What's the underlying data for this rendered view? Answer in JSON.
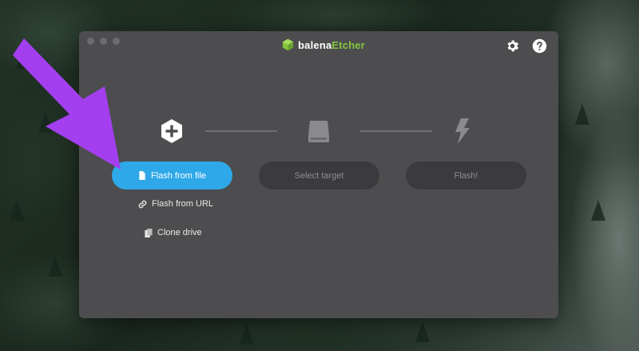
{
  "app": {
    "brand_prefix": "balena",
    "brand_suffix": "Etcher",
    "brand_accent_color": "#85c441"
  },
  "toolbar": {
    "settings_icon": "gear-icon",
    "help_icon": "question-circle-icon"
  },
  "steps": [
    {
      "icon": "plus-hexagon-icon",
      "button_label": "Flash from file",
      "state": "active"
    },
    {
      "icon": "drive-icon",
      "button_label": "Select target",
      "state": "disabled"
    },
    {
      "icon": "lightning-icon",
      "button_label": "Flash!",
      "state": "disabled"
    }
  ],
  "source_options": {
    "url_label": "Flash from URL",
    "clone_label": "Clone drive"
  },
  "colors": {
    "primary_button": "#2ea8e8",
    "window_bg": "#4d4d4f",
    "disabled_button": "#3b3b3d",
    "annotation_arrow": "#a43ff0"
  }
}
